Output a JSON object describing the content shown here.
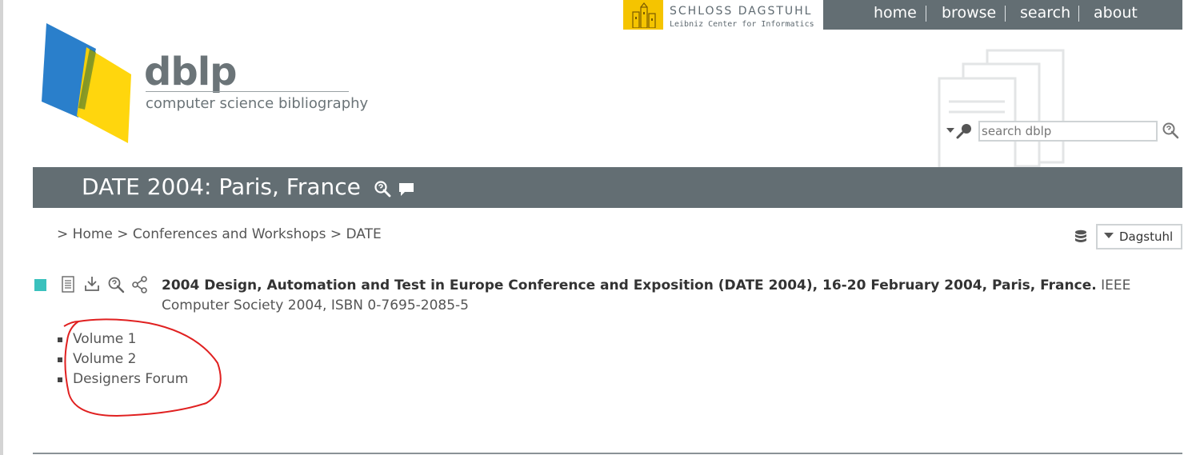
{
  "dagstuhl": {
    "name": "SCHLOSS DAGSTUHL",
    "subtitle": "Leibniz Center for Informatics"
  },
  "topnav": {
    "items": [
      {
        "label": "home"
      },
      {
        "label": "browse"
      },
      {
        "label": "search"
      },
      {
        "label": "about"
      }
    ]
  },
  "logo": {
    "word": "dblp",
    "tagline": "computer science bibliography"
  },
  "search": {
    "placeholder": "search dblp",
    "value": ""
  },
  "page": {
    "title": "DATE 2004: Paris, France"
  },
  "breadcrumb": {
    "prefix": ">",
    "items": [
      {
        "label": "Home"
      },
      {
        "label": "Conferences and Workshops"
      },
      {
        "label": "DATE"
      }
    ],
    "separator": ">"
  },
  "mirror": {
    "selected": "Dagstuhl"
  },
  "entry": {
    "title_bold": "2004 Design, Automation and Test in Europe Conference and Exposition (DATE 2004), 16-20 February 2004, Paris, France.",
    "publisher": " IEEE Computer Society 2004, ISBN 0-7695-2085-5",
    "marker_color": "#3ac1bd"
  },
  "volumes": [
    {
      "label": "Volume 1"
    },
    {
      "label": "Volume 2"
    },
    {
      "label": "Designers Forum"
    }
  ],
  "colors": {
    "nav_bg": "#636e73",
    "accent_yellow": "#f5c400",
    "logo_blue": "#1f78c8",
    "logo_yellow": "#ffd400",
    "annotation_red": "#e02020"
  },
  "icons": [
    "search-icon",
    "help-icon",
    "comment-icon",
    "document-icon",
    "download-icon",
    "share-icon",
    "database-icon"
  ]
}
